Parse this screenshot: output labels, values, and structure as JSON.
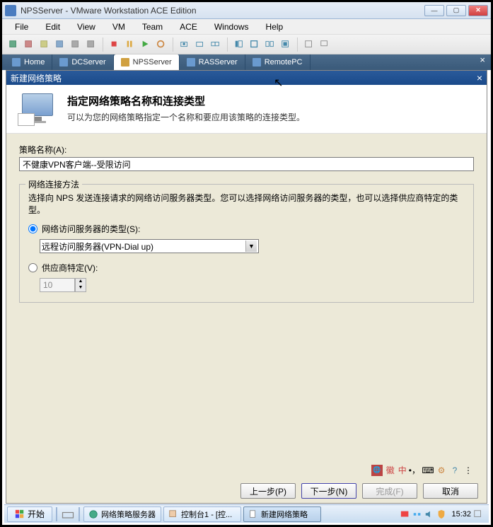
{
  "window": {
    "title": "NPSServer - VMware Workstation ACE Edition"
  },
  "menu": {
    "file": "File",
    "edit": "Edit",
    "view": "View",
    "vm": "VM",
    "team": "Team",
    "ace": "ACE",
    "windows": "Windows",
    "help": "Help"
  },
  "tabs": {
    "home": "Home",
    "dc": "DCServer",
    "nps": "NPSServer",
    "ras": "RASServer",
    "remote": "RemotePC"
  },
  "wizard": {
    "title": "新建网络策略",
    "heading": "指定网络策略名称和连接类型",
    "subheading": "可以为您的网络策略指定一个名称和要应用该策略的连接类型。",
    "policy_name_label": "策略名称(A):",
    "policy_name_value": "不健康VPN客户端--受限访问",
    "group_title": "网络连接方法",
    "group_desc": "选择向 NPS 发送连接请求的网络访问服务器类型。您可以选择网络访问服务器的类型，也可以选择供应商特定的类型。",
    "radio_server_type": "网络访问服务器的类型(S):",
    "server_type_value": "远程访问服务器(VPN-Dial up)",
    "radio_vendor": "供应商特定(V):",
    "vendor_value": "10",
    "lang_text": "中",
    "btn_prev": "上一步(P)",
    "btn_next": "下一步(N)",
    "btn_finish": "完成(F)",
    "btn_cancel": "取消"
  },
  "taskbar": {
    "start": "开始",
    "items": [
      "网络策略服务器",
      "控制台1 - [控...",
      "新建网络策略"
    ],
    "clock": "15:32"
  }
}
